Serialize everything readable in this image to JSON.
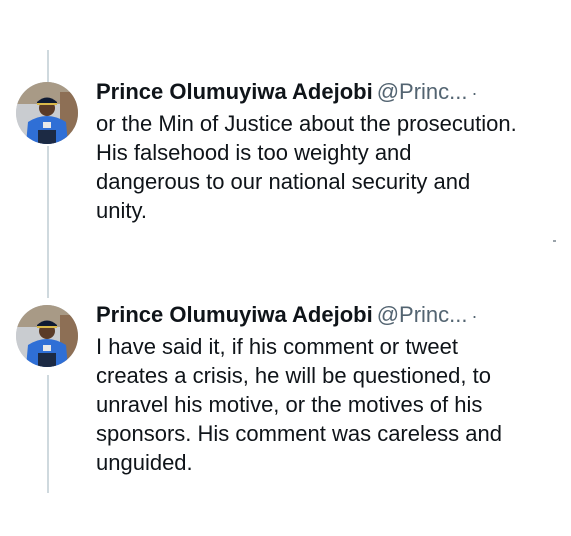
{
  "tweets": [
    {
      "author_name": "Prince Olumuyiwa Adejobi",
      "author_handle": "@Princ...",
      "separator": "·",
      "avatar_icon": "police-officer-avatar",
      "text": "or the Min of Justice about the prosecution.\nHis falsehood is too weighty and\ndangerous to our national security and\nunity."
    },
    {
      "author_name": "Prince Olumuyiwa Adejobi",
      "author_handle": "@Princ...",
      "separator": "·",
      "avatar_icon": "police-officer-avatar",
      "text": "I have said it, if his comment or tweet\ncreates a crisis, he will be questioned, to\nunravel his motive, or the motives of his\nsponsors. His comment was careless and\nunguided."
    }
  ],
  "colors": {
    "text_primary": "#0f1419",
    "text_secondary": "#536471",
    "thread_line": "#cfd9de",
    "uniform_blue": "#2f6fd6"
  }
}
